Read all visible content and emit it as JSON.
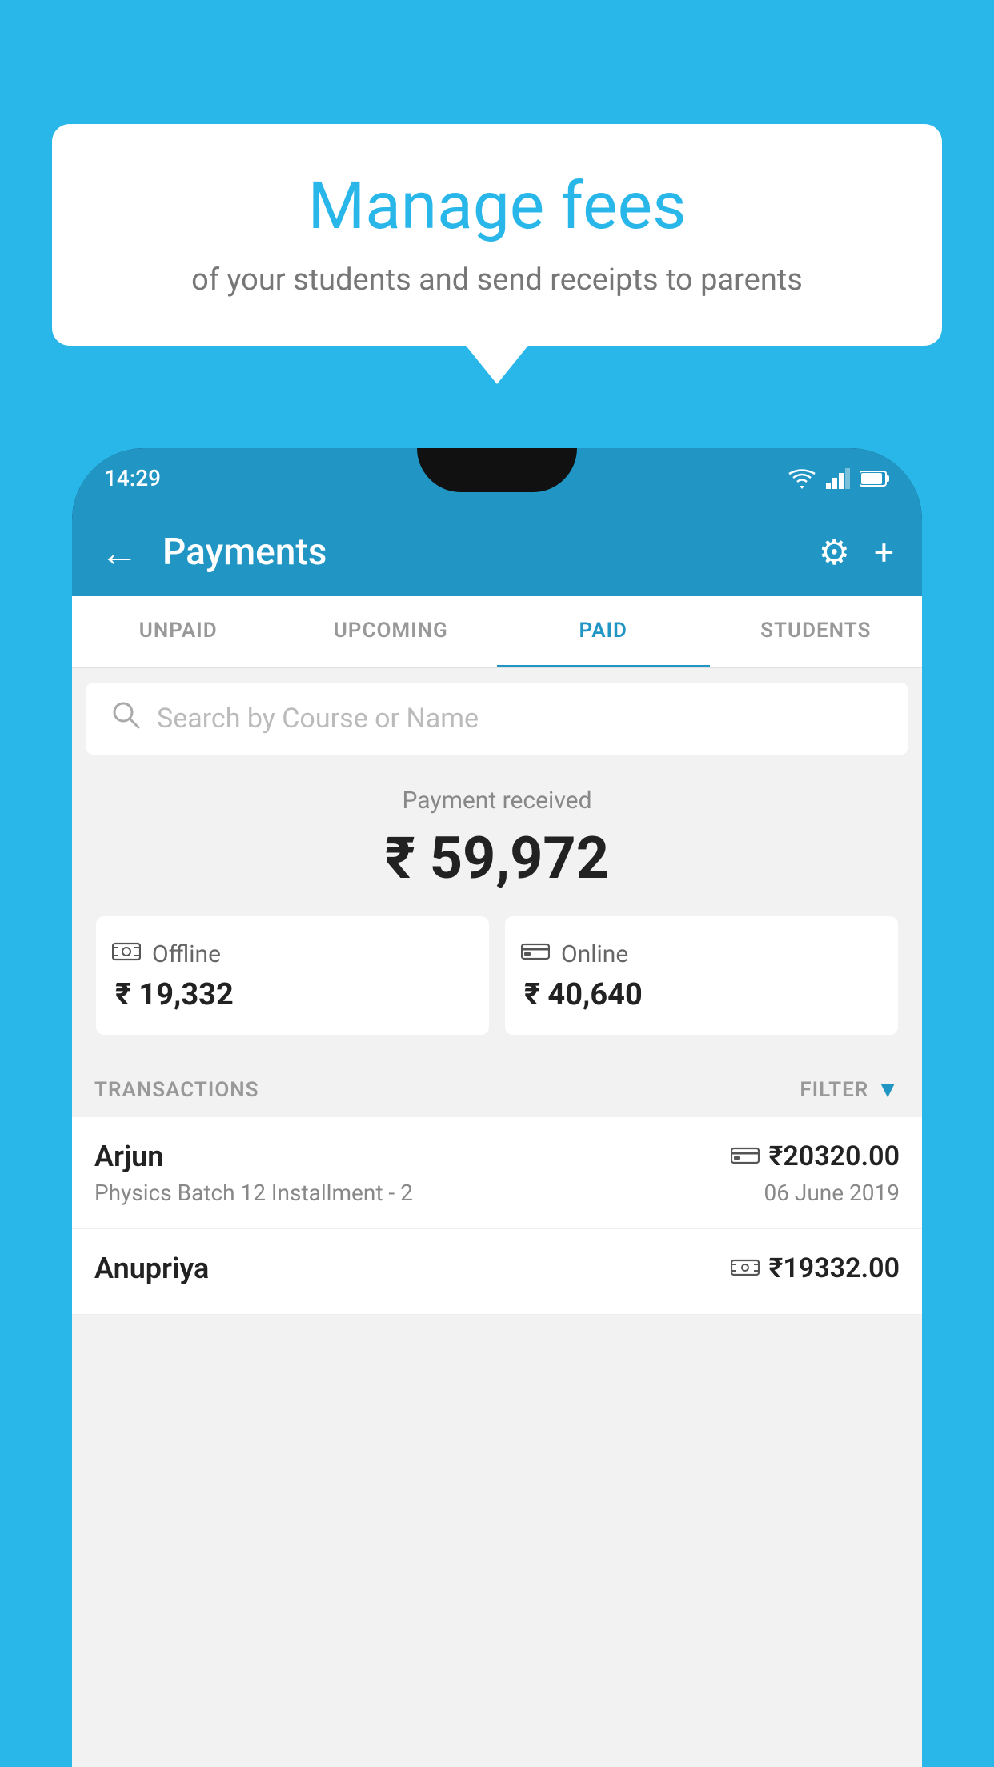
{
  "background_color": "#29b6e8",
  "speech_bubble": {
    "heading": "Manage fees",
    "subtext": "of your students and send receipts to parents"
  },
  "status_bar": {
    "time": "14:29",
    "wifi": true,
    "signal": true,
    "battery": true
  },
  "app_header": {
    "title": "Payments",
    "back_label": "←",
    "settings_label": "⚙",
    "add_label": "+"
  },
  "tabs": [
    {
      "id": "unpaid",
      "label": "UNPAID",
      "active": false
    },
    {
      "id": "upcoming",
      "label": "UPCOMING",
      "active": false
    },
    {
      "id": "paid",
      "label": "PAID",
      "active": true
    },
    {
      "id": "students",
      "label": "STUDENTS",
      "active": false
    }
  ],
  "search": {
    "placeholder": "Search by Course or Name"
  },
  "payment_summary": {
    "label": "Payment received",
    "total": "₹ 59,972",
    "offline_label": "Offline",
    "offline_amount": "₹ 19,332",
    "online_label": "Online",
    "online_amount": "₹ 40,640"
  },
  "transactions_section": {
    "label": "TRANSACTIONS",
    "filter_label": "FILTER"
  },
  "transactions": [
    {
      "name": "Arjun",
      "course": "Physics Batch 12 Installment - 2",
      "amount": "₹20320.00",
      "date": "06 June 2019",
      "mode": "card"
    },
    {
      "name": "Anupriya",
      "course": "",
      "amount": "₹19332.00",
      "date": "",
      "mode": "cash"
    }
  ]
}
